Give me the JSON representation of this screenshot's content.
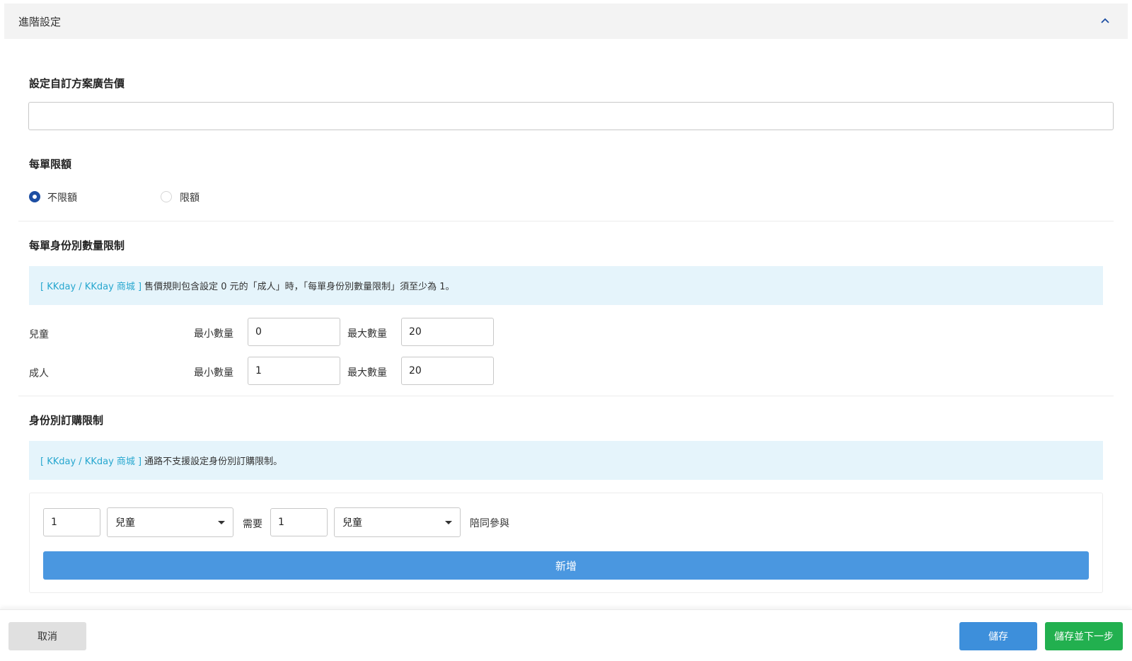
{
  "header": {
    "title": "進階設定",
    "collapse_icon": "chevron-up-icon"
  },
  "ad_price": {
    "label": "設定自訂方案廣告價",
    "value": ""
  },
  "order_limit": {
    "label": "每單限額",
    "options": [
      {
        "label": "不限額",
        "selected": true
      },
      {
        "label": "限額",
        "selected": false
      }
    ]
  },
  "identity_limit": {
    "label": "每單身份別數量限制",
    "notice_tag": "[ KKday / KKday 商城 ]",
    "notice_text": "售價規則包含設定 0 元的「成人」時，「每單身份別數量限制」須至少為 1。",
    "rows": [
      {
        "name": "兒童",
        "min_label": "最小數量",
        "min": "0",
        "max_label": "最大數量",
        "max": "20"
      },
      {
        "name": "成人",
        "min_label": "最小數量",
        "min": "1",
        "max_label": "最大數量",
        "max": "20"
      }
    ]
  },
  "purchase_limit": {
    "label": "身份別訂購限制",
    "notice_tag": "[ KKday / KKday 商城 ]",
    "notice_text": "通路不支援設定身份別訂購限制。",
    "rule": {
      "qty1": "1",
      "type1": "兒童",
      "need_label": "需要",
      "qty2": "1",
      "type2": "兒童",
      "suffix": "陪同參與"
    },
    "add_label": "新增"
  },
  "footer": {
    "cancel": "取消",
    "save": "儲存",
    "save_next": "儲存並下一步"
  },
  "colors": {
    "primary": "#3d8fdb",
    "success": "#22b04f",
    "radio": "#1d4ea3",
    "info_bg": "#e5f4fb",
    "info_tag": "#27a7cf"
  }
}
